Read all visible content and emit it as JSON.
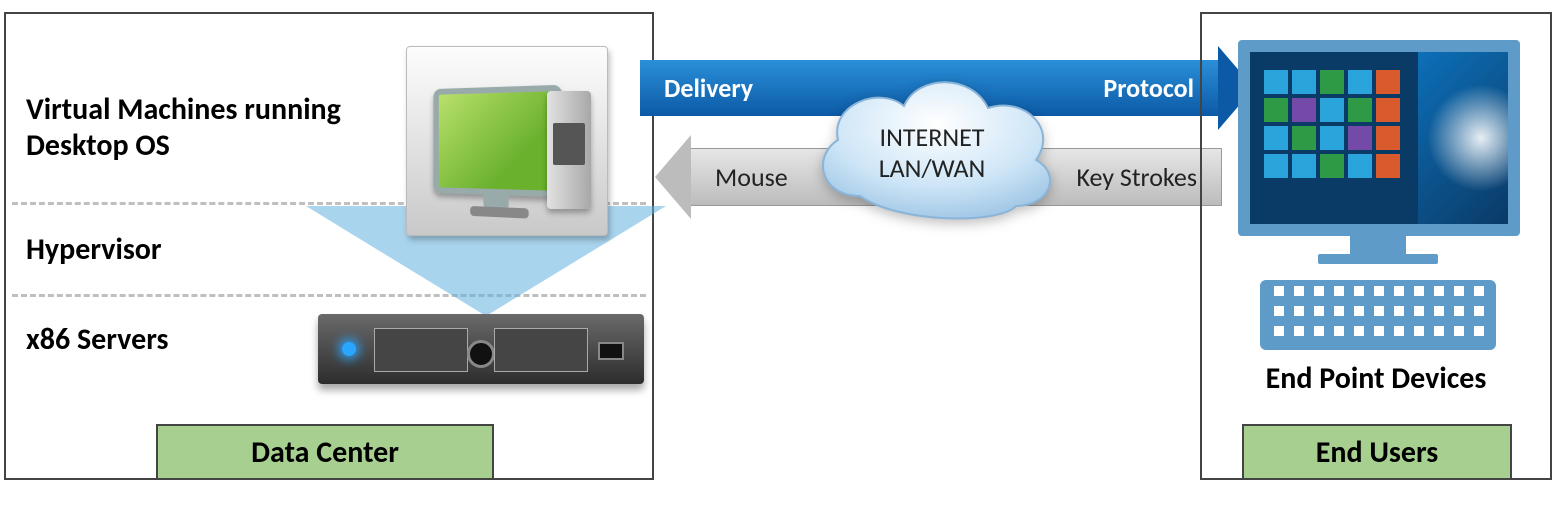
{
  "left_panel": {
    "vm_label": "Virtual Machines running Desktop OS",
    "hypervisor_label": "Hypervisor",
    "server_label": "x86 Servers",
    "tag": "Data Center"
  },
  "transport": {
    "delivery": "Delivery",
    "protocol": "Protocol",
    "mouse": "Mouse",
    "keystrokes": "Key Strokes"
  },
  "cloud": {
    "line1": "INTERNET",
    "line2": "LAN/WAN"
  },
  "right_panel": {
    "device_label": "End Point Devices",
    "tag": "End Users"
  }
}
